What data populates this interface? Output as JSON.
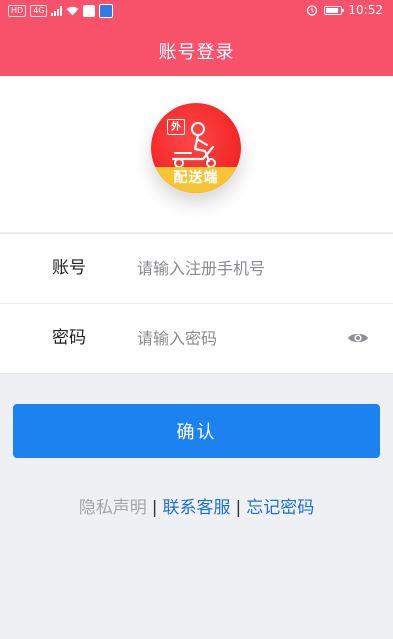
{
  "status_bar": {
    "left_chips": [
      "HD",
      "4G"
    ],
    "time": "10:52"
  },
  "header": {
    "title": "账号登录"
  },
  "logo": {
    "badge_text": "外",
    "band_text": "配送端",
    "colors": {
      "red": "#f32a2a",
      "yellow": "#f7c434"
    }
  },
  "form": {
    "account": {
      "label": "账号",
      "placeholder": "请输入注册手机号",
      "value": ""
    },
    "password": {
      "label": "密码",
      "placeholder": "请输入密码",
      "value": ""
    },
    "visibility_icon": "eye-icon"
  },
  "confirm_button": {
    "label": "确认",
    "color": "#1b82f0"
  },
  "links": {
    "privacy": "隐私声明",
    "separator": "|",
    "contact_service": "联系客服",
    "forgot_password": "忘记密码"
  },
  "colors": {
    "header": "#f8516a",
    "link": "#1972cf",
    "muted": "#a6a6aa"
  }
}
